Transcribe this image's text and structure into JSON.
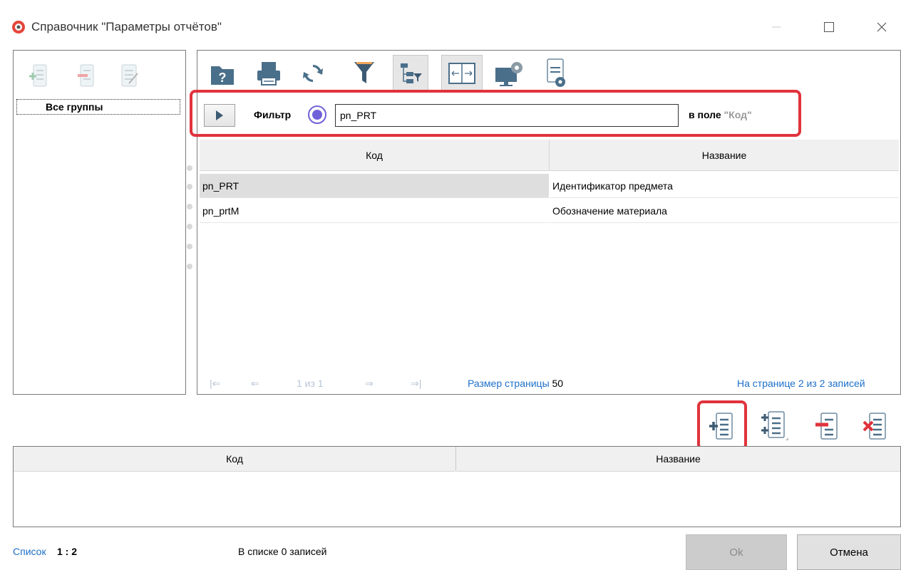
{
  "window": {
    "title": "Справочник \"Параметры отчётов\""
  },
  "groups": {
    "all_groups": "Все группы"
  },
  "filter": {
    "label": "Фильтр",
    "value": "pn_PRT",
    "field_prefix": "в поле ",
    "field_name": "\"Код\""
  },
  "grid": {
    "columns": [
      "Код",
      "Название"
    ],
    "rows": [
      {
        "code": "pn_PRT",
        "name": "Идентификатор предмета"
      },
      {
        "code": "pn_prtM",
        "name": "Обозначение материала"
      }
    ]
  },
  "pager": {
    "position": "1 из 1",
    "page_size_label": "Размер страницы",
    "page_size": "50",
    "summary": "На странице 2 из 2 записей"
  },
  "bottom_table": {
    "columns": [
      "Код",
      "Название"
    ]
  },
  "status": {
    "list_label": "Список",
    "ratio": "1 : 2",
    "records": "В списке 0 записей"
  },
  "buttons": {
    "ok": "Ok",
    "cancel": "Отмена"
  },
  "colors": {
    "highlight": "#e0333c",
    "link": "#1d6fc9",
    "radio": "#6f62d8"
  }
}
